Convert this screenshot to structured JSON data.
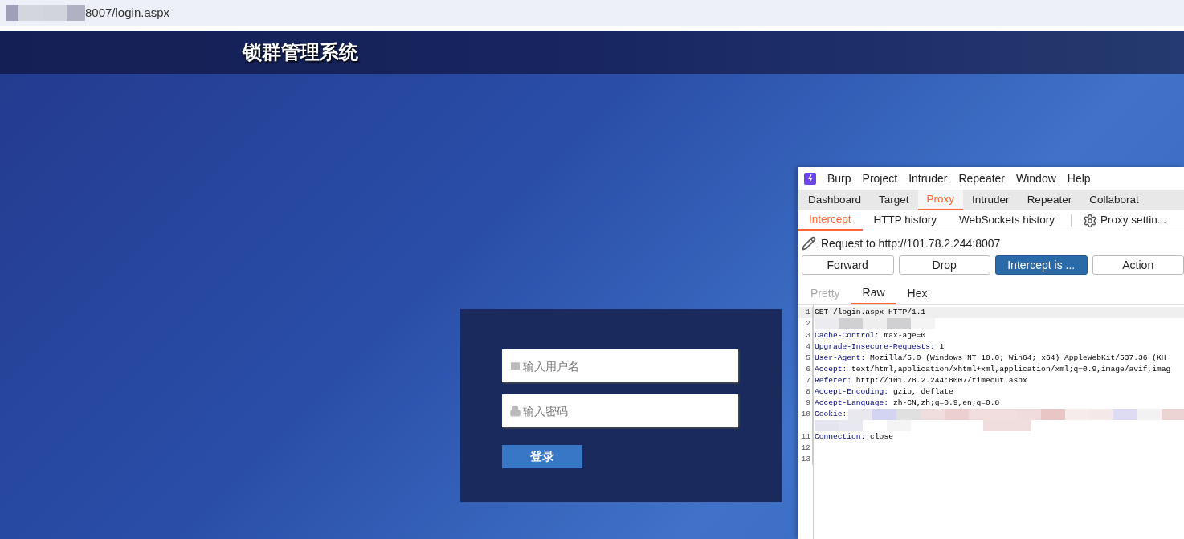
{
  "address_bar": {
    "url": "8007/login.aspx"
  },
  "header": {
    "title": "锁群管理系统"
  },
  "login": {
    "fields": [
      {
        "kind": "user",
        "placeholder": "输入用户名"
      },
      {
        "kind": "password",
        "placeholder": "输入密码"
      }
    ],
    "button": "登录"
  },
  "burp": {
    "menu": [
      "Burp",
      "Project",
      "Intruder",
      "Repeater",
      "Window",
      "Help"
    ],
    "tabs": [
      {
        "label": "Dashboard",
        "selected": false
      },
      {
        "label": "Target",
        "selected": false
      },
      {
        "label": "Proxy",
        "selected": true
      },
      {
        "label": "Intruder",
        "selected": false
      },
      {
        "label": "Repeater",
        "selected": false
      },
      {
        "label": "Collaborat",
        "selected": false
      }
    ],
    "subtabs": [
      {
        "label": "Intercept",
        "selected": true
      },
      {
        "label": "HTTP history",
        "selected": false
      },
      {
        "label": "WebSockets history",
        "selected": false
      }
    ],
    "settings": "Proxy settin...",
    "request": "Request to http://101.78.2.244:8007",
    "buttons": [
      {
        "label": "Forward",
        "selected": false
      },
      {
        "label": "Drop",
        "selected": false
      },
      {
        "label": "Intercept is ...",
        "selected": true
      },
      {
        "label": "Action",
        "selected": false
      }
    ],
    "editor_tabs": [
      {
        "label": "Pretty",
        "selected": false,
        "disabled": true
      },
      {
        "label": "Raw",
        "selected": true,
        "disabled": false
      },
      {
        "label": "Hex",
        "selected": false,
        "disabled": false
      }
    ],
    "lines": [
      {
        "number": "1",
        "kind": "request",
        "text": "GET /login.aspx HTTP/1.1",
        "current": true
      },
      {
        "number": "2",
        "kind": "redacted",
        "current": false
      },
      {
        "number": "3",
        "kind": "header",
        "key": "Cache-Control:",
        "value": "max-age=0",
        "current": false
      },
      {
        "number": "4",
        "kind": "header",
        "key": "Upgrade-Insecure-Requests:",
        "value": "1",
        "current": false
      },
      {
        "number": "5",
        "kind": "header",
        "key": "User-Agent:",
        "value": "Mozilla/5.0 (Windows NT 10.0; Win64; x64) AppleWebKit/537.36 (KH",
        "current": false
      },
      {
        "number": "6",
        "kind": "header",
        "key": "Accept:",
        "value": "text/html,application/xhtml+xml,application/xml;q=0.9,image/avif,imag",
        "current": false
      },
      {
        "number": "7",
        "kind": "header",
        "key": "Referer:",
        "value": "http://101.78.2.244:8007/timeout.aspx",
        "current": false
      },
      {
        "number": "8",
        "kind": "header",
        "key": "Accept-Encoding:",
        "value": "gzip, deflate",
        "current": false
      },
      {
        "number": "9",
        "kind": "header",
        "key": "Accept-Language:",
        "value": "zh-CN,zh;q=0.9,en;q=0.8",
        "current": false
      },
      {
        "number": "10",
        "kind": "redacted_header",
        "key": "Cookie:",
        "current": false
      },
      {
        "number": "11",
        "kind": "header",
        "key": "Connection:",
        "value": "close",
        "current": false
      },
      {
        "number": "12",
        "kind": "blank",
        "current": false
      },
      {
        "number": "13",
        "kind": "blank",
        "current": false
      }
    ]
  }
}
